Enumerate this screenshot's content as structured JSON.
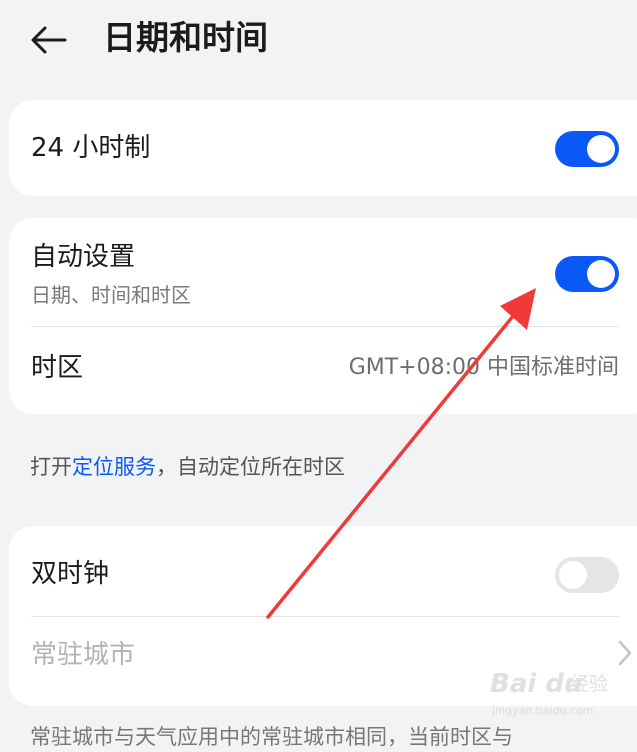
{
  "header": {
    "title": "日期和时间",
    "back_icon": "arrow-left-icon"
  },
  "card_24h": {
    "label": "24 小时制",
    "toggle_on": true
  },
  "card_auto": {
    "auto_label": "自动设置",
    "auto_sub": "日期、时间和时区",
    "auto_toggle_on": true,
    "timezone_label": "时区",
    "timezone_value": "GMT+08:00 中国标准时间"
  },
  "hint": {
    "prefix": "打开",
    "link": "定位服务",
    "suffix": "，自动定位所在时区"
  },
  "card_dual": {
    "dual_label": "双时钟",
    "dual_toggle_on": false,
    "city_label": "常驻城市"
  },
  "footer_text": "常驻城市与天气应用中的常驻城市相同，当前时区与",
  "colors": {
    "accent": "#0a59f7",
    "annotation_arrow": "#f03a3a",
    "background": "#f1f3f5"
  },
  "watermark": {
    "brand": "Bai du",
    "label": "经验",
    "url": "jingyan.baidu.com"
  }
}
